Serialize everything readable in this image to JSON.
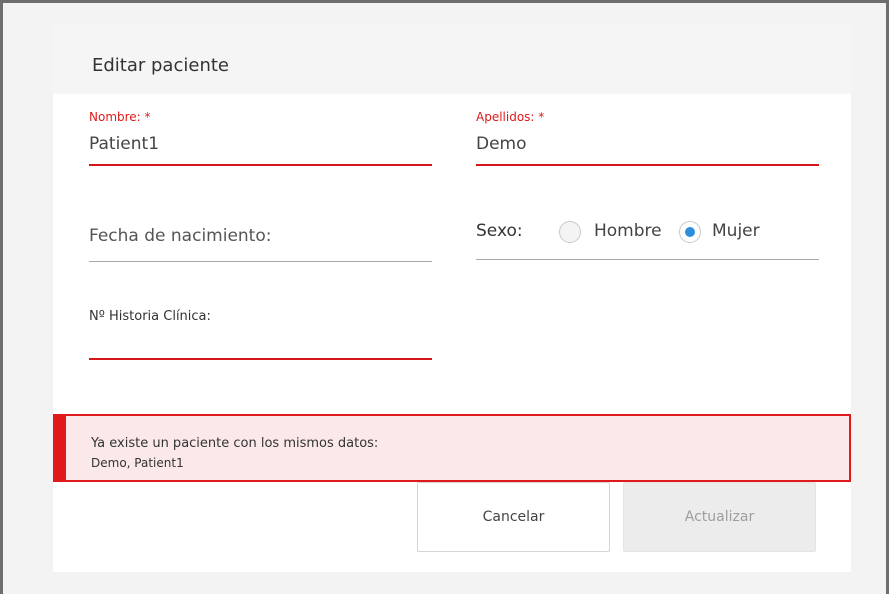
{
  "dialog": {
    "title": "Editar paciente"
  },
  "form": {
    "nombre": {
      "label": "Nombre: *",
      "value": "Patient1"
    },
    "apellidos": {
      "label": "Apellidos: *",
      "value": "Demo"
    },
    "fecha": {
      "label": "Fecha de nacimiento:",
      "value": ""
    },
    "sexo": {
      "label": "Sexo:",
      "options": [
        "Hombre",
        "Mujer"
      ],
      "selected": "Mujer"
    },
    "historia": {
      "label": "Nº Historia Clínica:",
      "value": ""
    }
  },
  "alert": {
    "title": "Ya existe un paciente con los mismos datos:",
    "detail": "Demo, Patient1",
    "color": "#e0191b"
  },
  "buttons": {
    "cancel": "Cancelar",
    "update": "Actualizar"
  },
  "colors": {
    "accent_error": "#e0191b",
    "radio_selected": "#2f8de0"
  }
}
